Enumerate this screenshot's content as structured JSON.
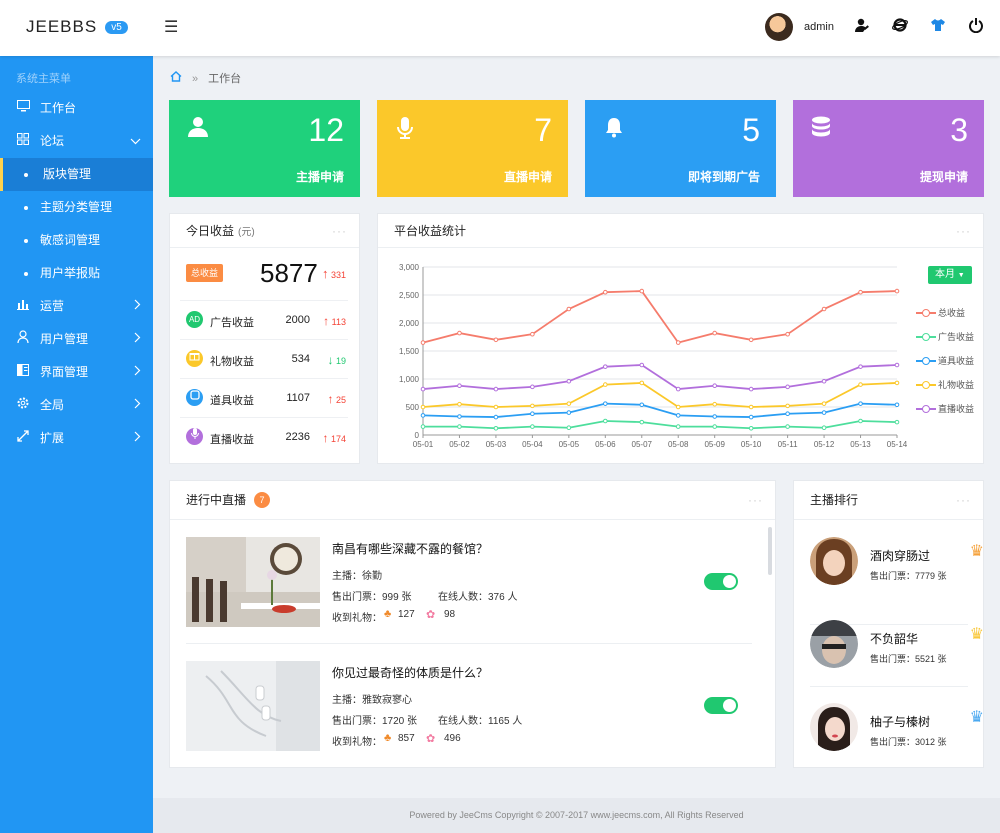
{
  "header": {
    "logo": "JEEBBS",
    "version": "v5",
    "username": "admin"
  },
  "sidebar": {
    "title": "系统主菜单",
    "items": [
      {
        "label": "工作台",
        "icon": "monitor-icon"
      },
      {
        "label": "论坛",
        "icon": "grid-icon",
        "expanded": true,
        "children": [
          {
            "label": "版块管理",
            "active": true
          },
          {
            "label": "主题分类管理"
          },
          {
            "label": "敏感词管理"
          },
          {
            "label": "用户举报贴"
          }
        ]
      },
      {
        "label": "运营",
        "icon": "bar-chart-icon"
      },
      {
        "label": "用户管理",
        "icon": "user-icon"
      },
      {
        "label": "界面管理",
        "icon": "layout-icon"
      },
      {
        "label": "全局",
        "icon": "gear-icon"
      },
      {
        "label": "扩展",
        "icon": "expand-icon"
      }
    ]
  },
  "breadcrumb": {
    "current": "工作台"
  },
  "stats": [
    {
      "value": "12",
      "label": "主播申请",
      "color": "#1fd17c",
      "icon": "user-icon"
    },
    {
      "value": "7",
      "label": "直播申请",
      "color": "#fbc82a",
      "icon": "microphone-icon"
    },
    {
      "value": "5",
      "label": "即将到期广告",
      "color": "#2b9ef3",
      "icon": "bell-icon"
    },
    {
      "value": "3",
      "label": "提现申请",
      "color": "#b26fdc",
      "icon": "database-icon"
    }
  ],
  "earnings": {
    "title": "今日收益",
    "unit": "(元)",
    "total_label": "总收益",
    "total": "5877",
    "total_delta": "331",
    "rows": [
      {
        "icon_text": "AD",
        "label": "广告收益",
        "value": "2000",
        "delta": "113",
        "dir": "up",
        "color": "#20c870"
      },
      {
        "icon_text": "礼",
        "label": "礼物收益",
        "value": "534",
        "delta": "19",
        "dir": "down",
        "color": "#fbc82a"
      },
      {
        "icon_text": "具",
        "label": "道具收益",
        "value": "1107",
        "delta": "25",
        "dir": "up",
        "color": "#2b9ef3"
      },
      {
        "icon_text": "播",
        "label": "直播收益",
        "value": "2236",
        "delta": "174",
        "dir": "up",
        "color": "#b26fdc"
      }
    ]
  },
  "chart": {
    "title": "平台收益统计",
    "period": "本月"
  },
  "chart_data": {
    "type": "line",
    "x": [
      "05-01",
      "05-02",
      "05-03",
      "05-04",
      "05-05",
      "05-06",
      "05-07",
      "05-08",
      "05-09",
      "05-10",
      "05-11",
      "05-12",
      "05-13",
      "05-14"
    ],
    "ylim": [
      0,
      3000
    ],
    "yticks": [
      "0",
      "500",
      "1,000",
      "1,500",
      "2,000",
      "2,500",
      "3,000"
    ],
    "grid": true,
    "legend": "right",
    "series": [
      {
        "name": "总收益",
        "color": "#f57c6c",
        "values": [
          1650,
          1820,
          1700,
          1800,
          2250,
          2550,
          2570,
          1650,
          1820,
          1700,
          1800,
          2250,
          2550,
          2570
        ]
      },
      {
        "name": "广告收益",
        "color": "#4dde9c",
        "values": [
          150,
          150,
          120,
          150,
          130,
          250,
          230,
          150,
          150,
          120,
          150,
          130,
          250,
          230
        ]
      },
      {
        "name": "道具收益",
        "color": "#2b9ef3",
        "values": [
          350,
          330,
          320,
          380,
          400,
          560,
          540,
          350,
          330,
          320,
          380,
          400,
          560,
          540
        ]
      },
      {
        "name": "礼物收益",
        "color": "#fbc82a",
        "values": [
          500,
          550,
          500,
          520,
          560,
          900,
          930,
          500,
          550,
          500,
          520,
          560,
          900,
          930
        ]
      },
      {
        "name": "直播收益",
        "color": "#b26fdc",
        "values": [
          820,
          880,
          820,
          860,
          960,
          1220,
          1250,
          820,
          880,
          820,
          860,
          960,
          1220,
          1250
        ]
      }
    ]
  },
  "live": {
    "title": "进行中直播",
    "count": "7",
    "items": [
      {
        "title": "南昌有哪些深藏不露的餐馆？",
        "host": "主播：徐勤",
        "sold": "售出门票：999 张",
        "online": "在线人数：376 人",
        "gift_label": "收到礼物：",
        "gift1": "127",
        "gift2": "98"
      },
      {
        "title": "你见过最奇怪的体质是什么？",
        "host": "主播：雅致寂寥心",
        "sold": "售出门票：1720 张",
        "online": "在线人数：1165 人",
        "gift_label": "收到礼物：",
        "gift1": "857",
        "gift2": "496"
      }
    ]
  },
  "ranking": {
    "title": "主播排行",
    "items": [
      {
        "name": "酒肉穿肠过",
        "sold": "售出门票：7779 张",
        "crown_color": "#f5a23c"
      },
      {
        "name": "不负韶华",
        "sold": "售出门票：5521 张",
        "crown_color": "#f9c83c"
      },
      {
        "name": "柚子与榛树",
        "sold": "售出门票：3012 张",
        "crown_color": "#4aa8f0"
      }
    ]
  },
  "footer": {
    "text": "Powered by JeeCms Copyright © 2007-2017 www.jeecms.com, All Rights Reserved"
  }
}
